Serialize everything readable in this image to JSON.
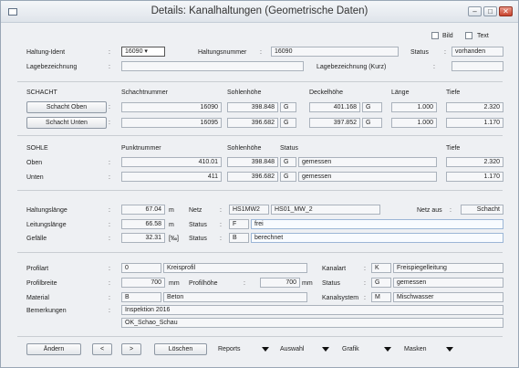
{
  "window": {
    "title": "Details: Kanalhaltungen (Geometrische Daten)",
    "minimize": "–",
    "maximize": "□",
    "close": "✕"
  },
  "options": {
    "bild": "Bild",
    "text": "Text"
  },
  "top": {
    "haltung_ident_label": "Haltung-Ident",
    "haltung_ident_value": "16090",
    "haltungsnummer_label": "Haltungsnummer",
    "haltungsnummer_value": "16090",
    "status_label": "Status",
    "status_value": "vorhanden",
    "lagebezeichnung_label": "Lagebezeichnung",
    "lagebezeichnung_value": "",
    "lagebezeichnung_kurz_label": "Lagebezeichnung (Kurz)",
    "lagebezeichnung_kurz_value": ""
  },
  "schacht": {
    "header": "SCHACHT",
    "col_nummer": "Schachtnummer",
    "col_sohle": "Sohlenhöhe",
    "col_deckel": "Deckelhöhe",
    "col_laenge": "Länge",
    "col_tiefe": "Tiefe",
    "rows": [
      {
        "button": "Schacht Oben",
        "nummer": "16090",
        "sohle": "398.848",
        "sohle_g": "G",
        "deckel": "401.168",
        "deckel_g": "G",
        "laenge": "1.000",
        "tiefe": "2.320"
      },
      {
        "button": "Schacht Unten",
        "nummer": "16095",
        "sohle": "396.682",
        "sohle_g": "G",
        "deckel": "397.852",
        "deckel_g": "G",
        "laenge": "1.000",
        "tiefe": "1.170"
      }
    ]
  },
  "sohle": {
    "header": "SOHLE",
    "col_punkt": "Punktnummer",
    "col_sohle": "Sohlenhöhe",
    "col_status": "Status",
    "col_tiefe": "Tiefe",
    "rows": [
      {
        "label": "Oben",
        "punkt": "410.01",
        "sohle": "398.848",
        "g": "G",
        "status": "gemessen",
        "tiefe": "2.320"
      },
      {
        "label": "Unten",
        "punkt": "411",
        "sohle": "396.682",
        "g": "G",
        "status": "gemessen",
        "tiefe": "1.170"
      }
    ]
  },
  "haltung": {
    "laenge_label": "Haltungslänge",
    "laenge_value": "67.04",
    "laenge_unit": "m",
    "netz_label": "Netz",
    "netz_code": "HS1MW2",
    "netz_name": "HS01_MW_2",
    "netz_aus_label": "Netz aus",
    "netz_aus_value": "Schacht",
    "leitung_label": "Leitungslänge",
    "leitung_value": "66.58",
    "leitung_unit": "m",
    "status1_label": "Status",
    "status1_code": "F",
    "status1_text": "frei",
    "gefaelle_label": "Gefälle",
    "gefaelle_value": "32.31",
    "gefaelle_unit": "[‰]",
    "status2_label": "Status",
    "status2_code": "B",
    "status2_text": "berechnet"
  },
  "profil": {
    "profilart_label": "Profilart",
    "profilart_code": "0",
    "profilart_text": "Kreisprofil",
    "kanalart_label": "Kanalart",
    "kanalart_code": "K",
    "kanalart_text": "Freispiegelleitung",
    "profilbreite_label": "Profilbreite",
    "profilbreite_value": "700",
    "profilbreite_unit": "mm",
    "profilhoehe_label": "Profilhöhe",
    "profilhoehe_value": "700",
    "profilhoehe_unit": "mm",
    "status_label": "Status",
    "status_code": "G",
    "status_text": "gemessen",
    "material_label": "Material",
    "material_code": "B",
    "material_text": "Beton",
    "kanalsystem_label": "Kanalsystem",
    "kanalsystem_code": "M",
    "kanalsystem_text": "Mischwasser",
    "bemerkungen_label": "Bemerkungen",
    "bemerkung1": "Inspektion 2016",
    "bemerkung2": "OK_Schao_Schau"
  },
  "toolbar": {
    "aendern": "Ändern",
    "prev": "<",
    "next": ">",
    "loeschen": "Löschen",
    "reports": "Reports",
    "auswahl": "Auswahl",
    "grafik": "Grafik",
    "masken": "Masken"
  }
}
